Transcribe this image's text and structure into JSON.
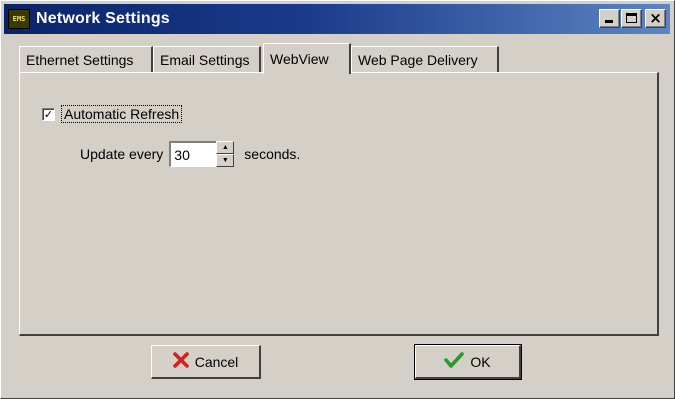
{
  "window": {
    "title": "Network Settings",
    "icon_name": "network-settings-app-icon",
    "icon_text": "EMS",
    "minimize_glyph": "_",
    "maximize_glyph": "□",
    "close_glyph": "×"
  },
  "tabs": [
    {
      "label": "Ethernet Settings",
      "active": false
    },
    {
      "label": "Email Settings",
      "active": false
    },
    {
      "label": "WebView",
      "active": true
    },
    {
      "label": "Web Page Delivery",
      "active": false
    }
  ],
  "webview": {
    "auto_refresh_label": "Automatic Refresh",
    "auto_refresh_checked": true,
    "check_glyph": "✓",
    "update_prefix": "Update every",
    "update_value": "30",
    "update_suffix": "seconds.",
    "spin_up_glyph": "▲",
    "spin_down_glyph": "▼"
  },
  "buttons": {
    "cancel_label": "Cancel",
    "cancel_icon": "red-x-icon",
    "ok_label": "OK",
    "ok_icon": "green-checkmark-icon"
  },
  "colors": {
    "title_bar_start": "#0a246a",
    "title_bar_end": "#5d85c4",
    "face": "#d4d0c8",
    "cancel_icon": "#d42020",
    "ok_icon": "#2a9a2a"
  }
}
